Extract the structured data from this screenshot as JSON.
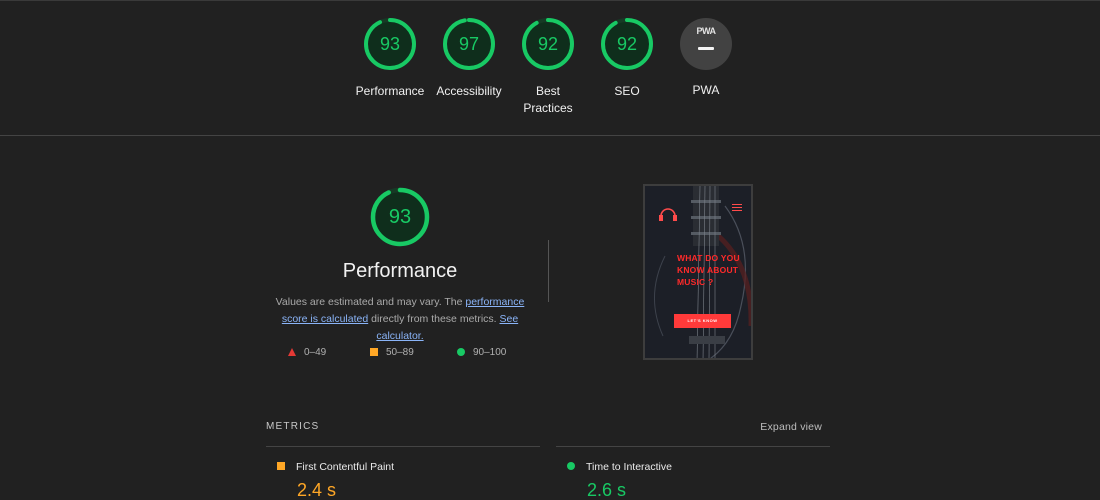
{
  "gauges": [
    {
      "score": "93",
      "label": "Performance"
    },
    {
      "score": "97",
      "label": "Accessibility"
    },
    {
      "score": "92",
      "label": "Best Practices"
    },
    {
      "score": "92",
      "label": "SEO"
    }
  ],
  "gauge_fraction": [
    0.93,
    0.97,
    0.92,
    0.92
  ],
  "pwa": {
    "badge_text": "PWA",
    "label": "PWA"
  },
  "performance": {
    "score": "93",
    "score_fraction": 0.93,
    "title": "Performance",
    "desc_prefix": "Values are estimated and may vary. The ",
    "link_score": "performance score is calculated",
    "desc_middle": " directly from these metrics. ",
    "link_calc": "See calculator."
  },
  "legend": {
    "fail": "0–49",
    "average": "50–89",
    "pass": "90–100"
  },
  "thumbnail": {
    "headline": "WHAT DO YOU KNOW ABOUT MUSIC ?",
    "cta": "LET'S KNOW"
  },
  "metrics": {
    "title": "METRICS",
    "expand_label": "Expand view",
    "items": [
      {
        "name": "First Contentful Paint",
        "value": "2.4 s",
        "status": "average"
      },
      {
        "name": "Time to Interactive",
        "value": "2.6 s",
        "status": "pass"
      }
    ]
  },
  "colors": {
    "pass": "#18c964",
    "average": "#ffa726",
    "fail": "#e53935",
    "background": "#212121",
    "link": "#8ab4f8"
  }
}
